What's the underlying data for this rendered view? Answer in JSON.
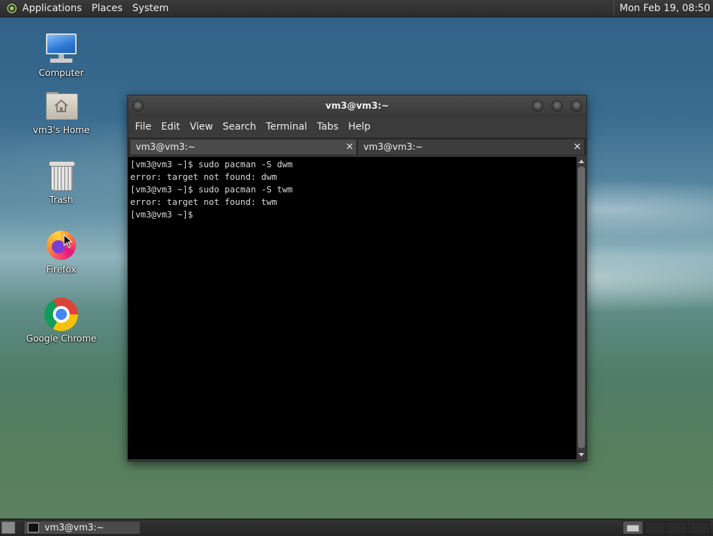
{
  "top_panel": {
    "menus": [
      "Applications",
      "Places",
      "System"
    ],
    "clock": "Mon Feb 19, 08:50"
  },
  "desktop_icons": [
    {
      "label": "Computer",
      "icon": "computer-icon"
    },
    {
      "label": "vm3's Home",
      "icon": "home-folder-icon"
    },
    {
      "label": "Trash",
      "icon": "trash-icon"
    },
    {
      "label": "Firefox",
      "icon": "firefox-icon"
    },
    {
      "label": "Google Chrome",
      "icon": "chrome-icon"
    }
  ],
  "terminal": {
    "title": "vm3@vm3:~",
    "menu": [
      "File",
      "Edit",
      "View",
      "Search",
      "Terminal",
      "Tabs",
      "Help"
    ],
    "tabs": [
      {
        "label": "vm3@vm3:~",
        "active": true
      },
      {
        "label": "vm3@vm3:~",
        "active": false
      }
    ],
    "lines": [
      "[vm3@vm3 ~]$ sudo pacman -S dwm",
      "error: target not found: dwm",
      "[vm3@vm3 ~]$ sudo pacman -S twm",
      "error: target not found: twm",
      "[vm3@vm3 ~]$"
    ]
  },
  "bottom_panel": {
    "task_label": "vm3@vm3:~"
  },
  "colors": {
    "terminal_bg": "#000000",
    "terminal_fg": "#d8d8d8",
    "panel_bg": "#2c2c2c"
  }
}
